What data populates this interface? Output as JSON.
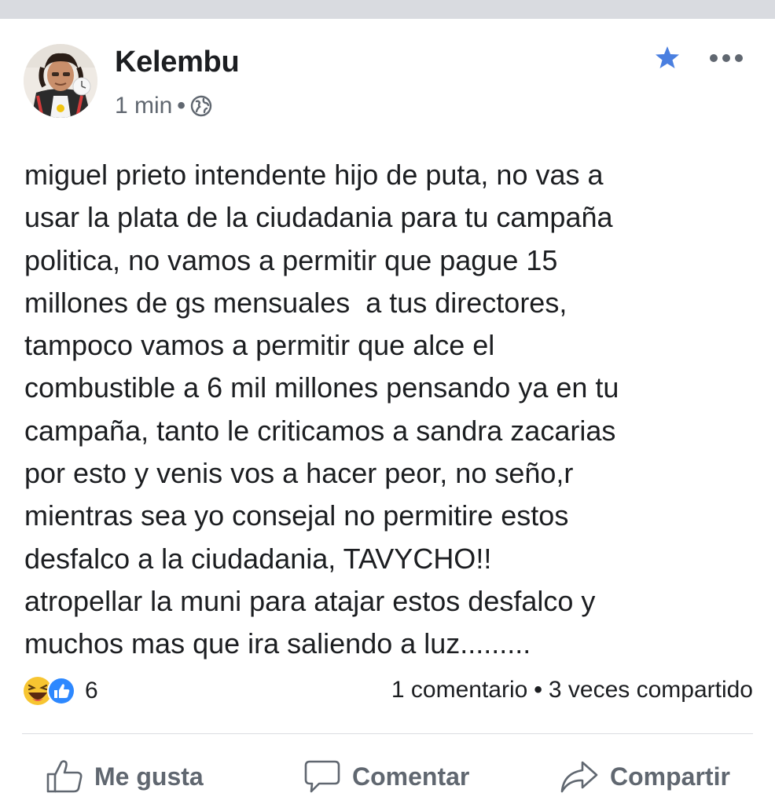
{
  "post": {
    "author": "Kelembu",
    "time": "1 min",
    "separator": "•",
    "privacy_icon": "globe-icon",
    "body": "miguel prieto intendente hijo de puta, no vas a\nusar la plata de la ciudadania para tu campaña\npolitica, no vamos a permitir que pague 15\nmillones de gs mensuales  a tus directores,\ntampoco vamos a permitir que alce el\ncombustible a 6 mil millones pensando ya en tu\ncampaña, tanto le criticamos a sandra zacarias\npor esto y venis vos a hacer peor, no seño,r\nmientras sea yo consejal no permitire estos\ndesfalco a la ciudadania, TAVYCHO!!\natropellar la muni para atajar estos desfalco y\nmuchos mas que ira saliendo a luz........."
  },
  "header_icons": {
    "favorite": "star-icon",
    "more": "more-options-icon"
  },
  "reactions": {
    "icons": [
      "haha-reaction-icon",
      "like-reaction-icon"
    ],
    "count": "6"
  },
  "stats": {
    "comments": "1 comentario",
    "separator": "•",
    "shares": "3 veces compartido"
  },
  "actions": {
    "like": "Me gusta",
    "comment": "Comentar",
    "share": "Compartir"
  },
  "colors": {
    "accent": "#4a7fe0",
    "secondary_text": "#606770",
    "primary_text": "#1c1e21"
  }
}
